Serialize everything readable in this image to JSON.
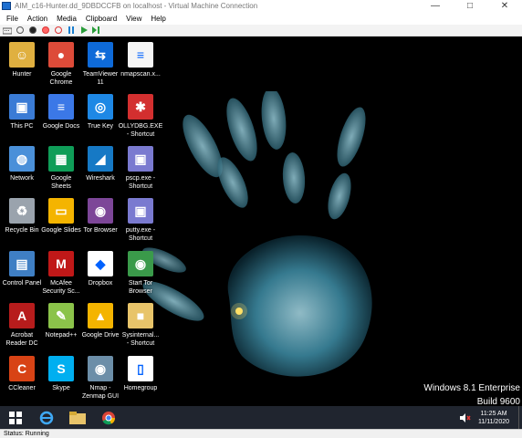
{
  "window": {
    "title": "AIM_c16-Hunter.dd_9DBDCCFB on localhost - Virtual Machine Connection",
    "controls": [
      "minimize",
      "maximize",
      "close"
    ]
  },
  "menu": [
    "File",
    "Action",
    "Media",
    "Clipboard",
    "View",
    "Help"
  ],
  "toolbar": {
    "buttons": [
      "ctrl-alt-del-icon",
      "start-icon",
      "turn-off-icon",
      "shut-down-icon",
      "save-icon",
      "pause-icon",
      "resume-icon",
      "reset-icon"
    ]
  },
  "desktop": {
    "icons": [
      {
        "label": "Hunter",
        "icon": "user-folder-icon",
        "color": "#e0b040"
      },
      {
        "label": "Google\nChrome",
        "icon": "chrome-icon",
        "color": "#dd4b39"
      },
      {
        "label": "TeamViewer\n11",
        "icon": "teamviewer-icon",
        "color": "#0e6ad8"
      },
      {
        "label": "nmapscan.x...",
        "icon": "document-icon",
        "color": "#f5f5f5"
      },
      {
        "label": "This PC",
        "icon": "this-pc-icon",
        "color": "#3a7bd5"
      },
      {
        "label": "Google Docs",
        "icon": "google-docs-icon",
        "color": "#3b78e7"
      },
      {
        "label": "True Key",
        "icon": "true-key-icon",
        "color": "#1e88e5"
      },
      {
        "label": "OLLYDBG.EXE\n- Shortcut",
        "icon": "ollydbg-icon",
        "color": "#d32f2f"
      },
      {
        "label": "Network",
        "icon": "network-icon",
        "color": "#4a90d9"
      },
      {
        "label": "Google\nSheets",
        "icon": "google-sheets-icon",
        "color": "#0f9d58"
      },
      {
        "label": "Wireshark",
        "icon": "wireshark-icon",
        "color": "#1679c5"
      },
      {
        "label": "pscp.exe -\nShortcut",
        "icon": "pscp-icon",
        "color": "#7a7ad0"
      },
      {
        "label": "Recycle Bin",
        "icon": "recycle-bin-icon",
        "color": "#9aa3ad"
      },
      {
        "label": "Google Slides",
        "icon": "google-slides-icon",
        "color": "#f4b400"
      },
      {
        "label": "Tor Browser",
        "icon": "tor-browser-icon",
        "color": "#7d4698"
      },
      {
        "label": "putty.exe -\nShortcut",
        "icon": "putty-icon",
        "color": "#7a7ad0"
      },
      {
        "label": "Control Panel",
        "icon": "control-panel-icon",
        "color": "#3f7fc4"
      },
      {
        "label": "McAfee\nSecurity Sc...",
        "icon": "mcafee-icon",
        "color": "#c01818"
      },
      {
        "label": "Dropbox",
        "icon": "dropbox-icon",
        "color": "#ffffff"
      },
      {
        "label": "Start Tor\nBrowser",
        "icon": "start-tor-icon",
        "color": "#3a9a4a"
      },
      {
        "label": "Acrobat\nReader DC",
        "icon": "acrobat-icon",
        "color": "#b71c1c"
      },
      {
        "label": "Notepad++",
        "icon": "notepadpp-icon",
        "color": "#8bc34a"
      },
      {
        "label": "Google Drive",
        "icon": "google-drive-icon",
        "color": "#f4b400"
      },
      {
        "label": "Sysinternal...\n- Shortcut",
        "icon": "folder-icon",
        "color": "#e8c46a"
      },
      {
        "label": "CCleaner",
        "icon": "ccleaner-icon",
        "color": "#d84315"
      },
      {
        "label": "Skype",
        "icon": "skype-icon",
        "color": "#00aff0"
      },
      {
        "label": "Nmap -\nZenmap GUI",
        "icon": "nmap-icon",
        "color": "#6c8ea8"
      },
      {
        "label": "Homegroup",
        "icon": "homegroup-icon",
        "color": "#ffffff"
      }
    ],
    "edition": "Windows 8.1 Enterprise",
    "build": "Build 9600"
  },
  "taskbar": {
    "buttons": [
      "windows-start-icon",
      "internet-explorer-icon",
      "file-explorer-icon",
      "chrome-taskbar-icon"
    ],
    "time": "11:25 AM",
    "date": "11/11/2020"
  },
  "status": "Status: Running"
}
